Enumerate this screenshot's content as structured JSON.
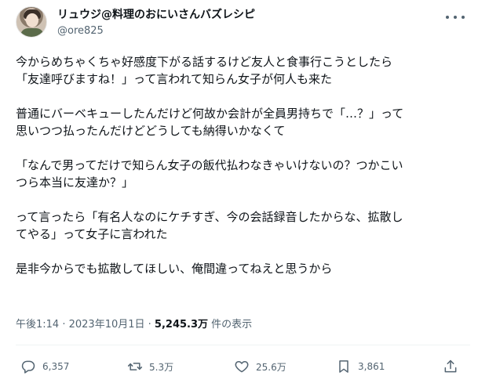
{
  "author": {
    "display_name": "リュウジ@料理のおにいさんバズレシピ",
    "handle": "@ore825"
  },
  "tweet": {
    "paragraphs": [
      "今からめちゃくちゃ好感度下がる話するけど友人と食事行こうとしたら\n「友達呼びますね！」って言われて知らん女子が何人も来た",
      "普通にバーベキューしたんだけど何故か会計が全員男持ちで「…？」って\n思いつつ払ったんだけどどうしても納得いかなくて",
      "「なんで男ってだけで知らん女子の飯代払わなきゃいけないの？つかこい\nつら本当に友達か？」",
      "って言ったら「有名人なのにケチすぎ、今の会話録音したからな、拡散し\nてやる」って女子に言われた",
      "是非今からでも拡散してほしい、俺間違ってねえと思うから"
    ]
  },
  "meta": {
    "time": "午後1:14",
    "separator": " · ",
    "date": "2023年10月1日",
    "views_count": "5,245.3万",
    "views_label": " 件の表示"
  },
  "actions": {
    "reply_count": "6,357",
    "repost_count": "5.3万",
    "like_count": "25.6万",
    "bookmark_count": "3,861"
  },
  "icons": {
    "more": "more-options-icon",
    "reply": "reply-icon",
    "repost": "repost-icon",
    "like": "heart-icon",
    "bookmark": "bookmark-icon",
    "share": "share-icon"
  },
  "colors": {
    "text": "#0f1419",
    "secondary": "#536471",
    "divider": "#eff3f4"
  }
}
